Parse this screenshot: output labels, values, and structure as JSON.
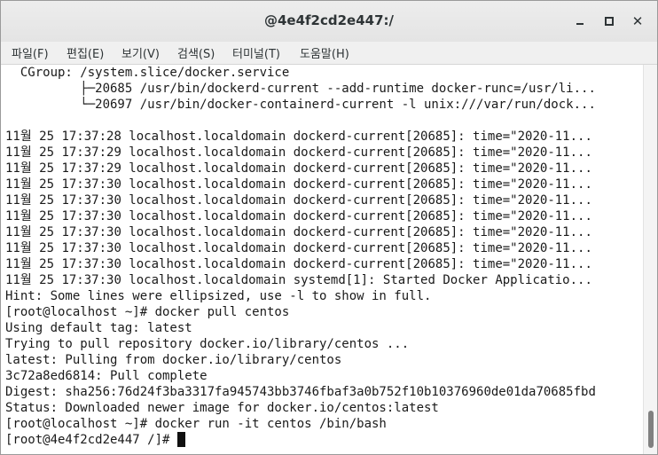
{
  "window": {
    "title": "@4e4f2cd2e447:/",
    "buttons": {
      "minimize": "minimize",
      "maximize": "maximize",
      "close": "✕"
    }
  },
  "menu": [
    "파일(F)",
    "편집(E)",
    "보기(V)",
    "검색(S)",
    "터미널(T)",
    "도움말(H)"
  ],
  "terminal": {
    "lines": [
      "  CGroup: /system.slice/docker.service",
      "          ├─20685 /usr/bin/dockerd-current --add-runtime docker-runc=/usr/li...",
      "          └─20697 /usr/bin/docker-containerd-current -l unix:///var/run/dock...",
      "",
      "11월 25 17:37:28 localhost.localdomain dockerd-current[20685]: time=\"2020-11...",
      "11월 25 17:37:29 localhost.localdomain dockerd-current[20685]: time=\"2020-11...",
      "11월 25 17:37:29 localhost.localdomain dockerd-current[20685]: time=\"2020-11...",
      "11월 25 17:37:30 localhost.localdomain dockerd-current[20685]: time=\"2020-11...",
      "11월 25 17:37:30 localhost.localdomain dockerd-current[20685]: time=\"2020-11...",
      "11월 25 17:37:30 localhost.localdomain dockerd-current[20685]: time=\"2020-11...",
      "11월 25 17:37:30 localhost.localdomain dockerd-current[20685]: time=\"2020-11...",
      "11월 25 17:37:30 localhost.localdomain dockerd-current[20685]: time=\"2020-11...",
      "11월 25 17:37:30 localhost.localdomain dockerd-current[20685]: time=\"2020-11...",
      "11월 25 17:37:30 localhost.localdomain systemd[1]: Started Docker Applicatio...",
      "Hint: Some lines were ellipsized, use -l to show in full.",
      "[root@localhost ~]# docker pull centos",
      "Using default tag: latest",
      "Trying to pull repository docker.io/library/centos ...",
      "latest: Pulling from docker.io/library/centos",
      "3c72a8ed6814: Pull complete",
      "Digest: sha256:76d24f3ba3317fa945743bb3746fbaf3a0b752f10b10376960de01da70685fbd",
      "Status: Downloaded newer image for docker.io/centos:latest",
      "[root@localhost ~]# docker run -it centos /bin/bash",
      "[root@4e4f2cd2e447 /]# "
    ]
  }
}
